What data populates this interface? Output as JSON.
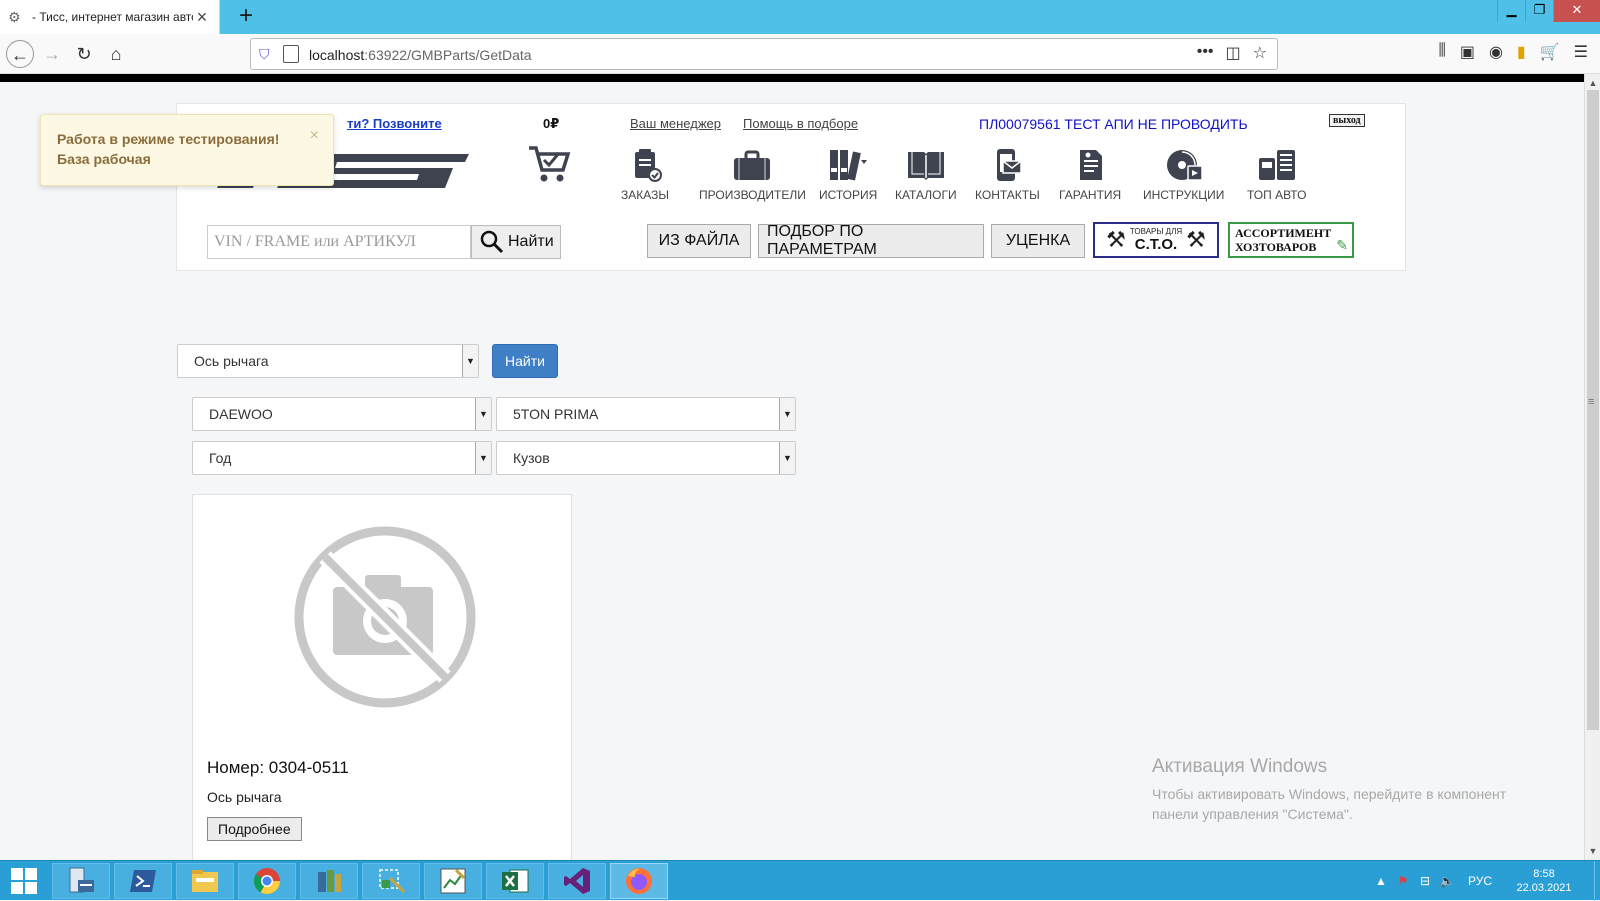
{
  "browser": {
    "tab_title": "- Тисс, интернет магазин авто",
    "url_host": "localhost",
    "url_rest": ":63922/GMBParts/GetData"
  },
  "header": {
    "phone_link": "ти? Позвоните",
    "balance": "0₽",
    "manager_link": "Ваш менеджер",
    "help_link": "Помощь в подборе",
    "account": "ПЛ00079561 ТЕСТ АПИ НЕ ПРОВОДИТЬ",
    "exit": "выход",
    "menu": [
      {
        "label": "ЗАКАЗЫ",
        "icon": "orders-icon"
      },
      {
        "label": "ПРОИЗВОДИТЕЛИ",
        "icon": "briefcase-icon"
      },
      {
        "label": "ИСТОРИЯ",
        "icon": "binders-icon"
      },
      {
        "label": "КАТАЛОГИ",
        "icon": "book-icon"
      },
      {
        "label": "КОНТАКТЫ",
        "icon": "phone-mail-icon"
      },
      {
        "label": "ГАРАНТИЯ",
        "icon": "document-icon"
      },
      {
        "label": "ИНСТРУКЦИИ",
        "icon": "disc-icon"
      },
      {
        "label": "ТОП АВТО",
        "icon": "top-auto-icon"
      }
    ],
    "search_placeholder": "VIN / FRAME или АРТИКУЛ",
    "search_button": "Найти",
    "from_file": "ИЗ ФАЙЛА",
    "by_params": "ПОДБОР ПО ПАРАМЕТРАМ",
    "discount": "УЦЕНКА",
    "sto_top": "ТОВАРЫ ДЛЯ",
    "sto_main": "С.Т.О.",
    "assort_line1": "АССОРТИМЕНТ",
    "assort_line2": "ХОЗТОВАРОВ"
  },
  "toast": {
    "line1": "Работа в режиме тестирования!",
    "line2": "База рабочая",
    "close": "×"
  },
  "filters": {
    "part_select": "Ось рычага",
    "find_button": "Найти",
    "brand": "DAEWOO",
    "model": "5TON PRIMA",
    "year": "Год",
    "body": "Кузов"
  },
  "product": {
    "number": "Номер: 0304-0511",
    "name": "Ось рычага",
    "details_button": "Подробнее"
  },
  "watermark": {
    "title": "Активация Windows",
    "line1": "Чтобы активировать Windows, перейдите в компонент",
    "line2": "панели управления \"Система\"."
  },
  "tray": {
    "lang": "РУС",
    "time": "8:58",
    "date": "22.03.2021"
  },
  "colors": {
    "tabbar": "#4fc0e8",
    "taskbar": "#2a9fd6",
    "primary_button": "#3f7fc6",
    "toast_bg": "#fcf8e3"
  }
}
